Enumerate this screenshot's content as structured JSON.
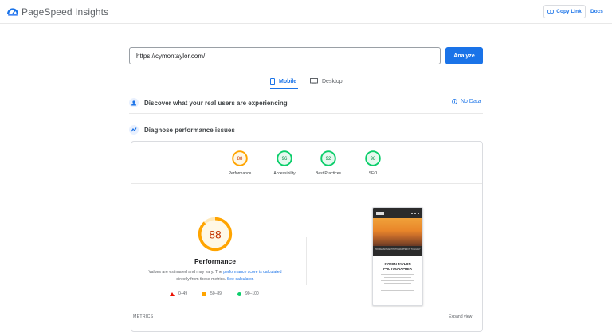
{
  "app": {
    "title": "PageSpeed Insights",
    "copy_link": "Copy Link",
    "docs": "Docs"
  },
  "search": {
    "url_value": "https://cymontaylor.com/",
    "analyze_label": "Analyze"
  },
  "tabs": [
    {
      "label": "Mobile",
      "selected": true
    },
    {
      "label": "Desktop",
      "selected": false
    }
  ],
  "discover": {
    "title": "Discover what your real users are experiencing",
    "status": "No Data"
  },
  "diagnose": {
    "title": "Diagnose performance issues"
  },
  "scores": [
    {
      "label": "Performance",
      "value": "88",
      "color": "#ffa400"
    },
    {
      "label": "Accessibility",
      "value": "96",
      "color": "#0cce6b"
    },
    {
      "label": "Best Practices",
      "value": "92",
      "color": "#0cce6b"
    },
    {
      "label": "SEO",
      "value": "98",
      "color": "#0cce6b"
    }
  ],
  "performance": {
    "score": "88",
    "title": "Performance",
    "desc_prefix": "Values are estimated and may vary. The ",
    "desc_link": "performance score is calculated",
    "desc_mid": " directly from these metrics. ",
    "desc_link2": "See calculator."
  },
  "legend": [
    {
      "range": "0–49",
      "color": "#eb0f00"
    },
    {
      "range": "50–89",
      "color": "#ffa400"
    },
    {
      "range": "90–100",
      "color": "#0cce6b"
    }
  ],
  "preview": {
    "banner": "PROFESSIONAL PHOTOGRAPHER IN TUSCANY",
    "name_line1": "CYMON TAYLOR",
    "name_line2": "PHOTOGRAPHER"
  },
  "footer": {
    "metrics_label": "METRICS",
    "expand_label": "Expand view"
  }
}
